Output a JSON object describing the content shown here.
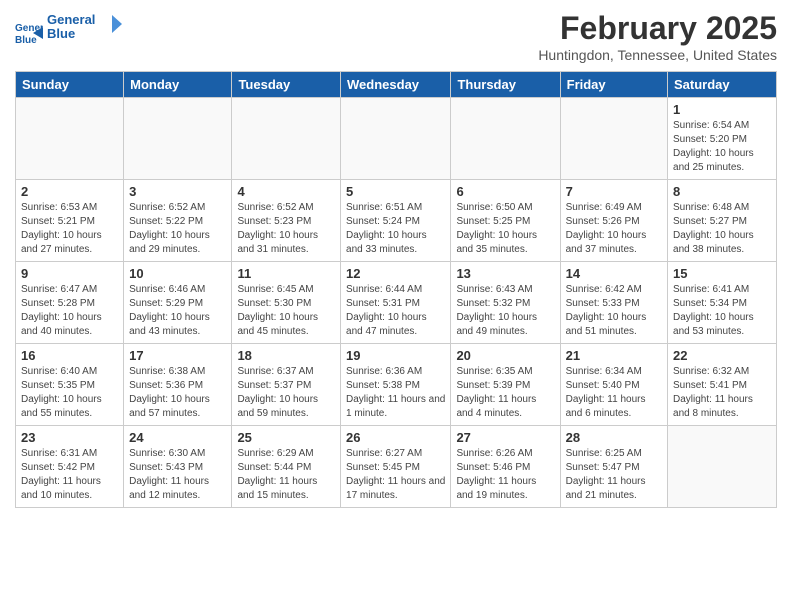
{
  "header": {
    "logo_line1": "General",
    "logo_line2": "Blue",
    "title": "February 2025",
    "subtitle": "Huntingdon, Tennessee, United States"
  },
  "weekdays": [
    "Sunday",
    "Monday",
    "Tuesday",
    "Wednesday",
    "Thursday",
    "Friday",
    "Saturday"
  ],
  "weeks": [
    [
      {
        "day": "",
        "info": ""
      },
      {
        "day": "",
        "info": ""
      },
      {
        "day": "",
        "info": ""
      },
      {
        "day": "",
        "info": ""
      },
      {
        "day": "",
        "info": ""
      },
      {
        "day": "",
        "info": ""
      },
      {
        "day": "1",
        "info": "Sunrise: 6:54 AM\nSunset: 5:20 PM\nDaylight: 10 hours and 25 minutes."
      }
    ],
    [
      {
        "day": "2",
        "info": "Sunrise: 6:53 AM\nSunset: 5:21 PM\nDaylight: 10 hours and 27 minutes."
      },
      {
        "day": "3",
        "info": "Sunrise: 6:52 AM\nSunset: 5:22 PM\nDaylight: 10 hours and 29 minutes."
      },
      {
        "day": "4",
        "info": "Sunrise: 6:52 AM\nSunset: 5:23 PM\nDaylight: 10 hours and 31 minutes."
      },
      {
        "day": "5",
        "info": "Sunrise: 6:51 AM\nSunset: 5:24 PM\nDaylight: 10 hours and 33 minutes."
      },
      {
        "day": "6",
        "info": "Sunrise: 6:50 AM\nSunset: 5:25 PM\nDaylight: 10 hours and 35 minutes."
      },
      {
        "day": "7",
        "info": "Sunrise: 6:49 AM\nSunset: 5:26 PM\nDaylight: 10 hours and 37 minutes."
      },
      {
        "day": "8",
        "info": "Sunrise: 6:48 AM\nSunset: 5:27 PM\nDaylight: 10 hours and 38 minutes."
      }
    ],
    [
      {
        "day": "9",
        "info": "Sunrise: 6:47 AM\nSunset: 5:28 PM\nDaylight: 10 hours and 40 minutes."
      },
      {
        "day": "10",
        "info": "Sunrise: 6:46 AM\nSunset: 5:29 PM\nDaylight: 10 hours and 43 minutes."
      },
      {
        "day": "11",
        "info": "Sunrise: 6:45 AM\nSunset: 5:30 PM\nDaylight: 10 hours and 45 minutes."
      },
      {
        "day": "12",
        "info": "Sunrise: 6:44 AM\nSunset: 5:31 PM\nDaylight: 10 hours and 47 minutes."
      },
      {
        "day": "13",
        "info": "Sunrise: 6:43 AM\nSunset: 5:32 PM\nDaylight: 10 hours and 49 minutes."
      },
      {
        "day": "14",
        "info": "Sunrise: 6:42 AM\nSunset: 5:33 PM\nDaylight: 10 hours and 51 minutes."
      },
      {
        "day": "15",
        "info": "Sunrise: 6:41 AM\nSunset: 5:34 PM\nDaylight: 10 hours and 53 minutes."
      }
    ],
    [
      {
        "day": "16",
        "info": "Sunrise: 6:40 AM\nSunset: 5:35 PM\nDaylight: 10 hours and 55 minutes."
      },
      {
        "day": "17",
        "info": "Sunrise: 6:38 AM\nSunset: 5:36 PM\nDaylight: 10 hours and 57 minutes."
      },
      {
        "day": "18",
        "info": "Sunrise: 6:37 AM\nSunset: 5:37 PM\nDaylight: 10 hours and 59 minutes."
      },
      {
        "day": "19",
        "info": "Sunrise: 6:36 AM\nSunset: 5:38 PM\nDaylight: 11 hours and 1 minute."
      },
      {
        "day": "20",
        "info": "Sunrise: 6:35 AM\nSunset: 5:39 PM\nDaylight: 11 hours and 4 minutes."
      },
      {
        "day": "21",
        "info": "Sunrise: 6:34 AM\nSunset: 5:40 PM\nDaylight: 11 hours and 6 minutes."
      },
      {
        "day": "22",
        "info": "Sunrise: 6:32 AM\nSunset: 5:41 PM\nDaylight: 11 hours and 8 minutes."
      }
    ],
    [
      {
        "day": "23",
        "info": "Sunrise: 6:31 AM\nSunset: 5:42 PM\nDaylight: 11 hours and 10 minutes."
      },
      {
        "day": "24",
        "info": "Sunrise: 6:30 AM\nSunset: 5:43 PM\nDaylight: 11 hours and 12 minutes."
      },
      {
        "day": "25",
        "info": "Sunrise: 6:29 AM\nSunset: 5:44 PM\nDaylight: 11 hours and 15 minutes."
      },
      {
        "day": "26",
        "info": "Sunrise: 6:27 AM\nSunset: 5:45 PM\nDaylight: 11 hours and 17 minutes."
      },
      {
        "day": "27",
        "info": "Sunrise: 6:26 AM\nSunset: 5:46 PM\nDaylight: 11 hours and 19 minutes."
      },
      {
        "day": "28",
        "info": "Sunrise: 6:25 AM\nSunset: 5:47 PM\nDaylight: 11 hours and 21 minutes."
      },
      {
        "day": "",
        "info": ""
      }
    ]
  ]
}
